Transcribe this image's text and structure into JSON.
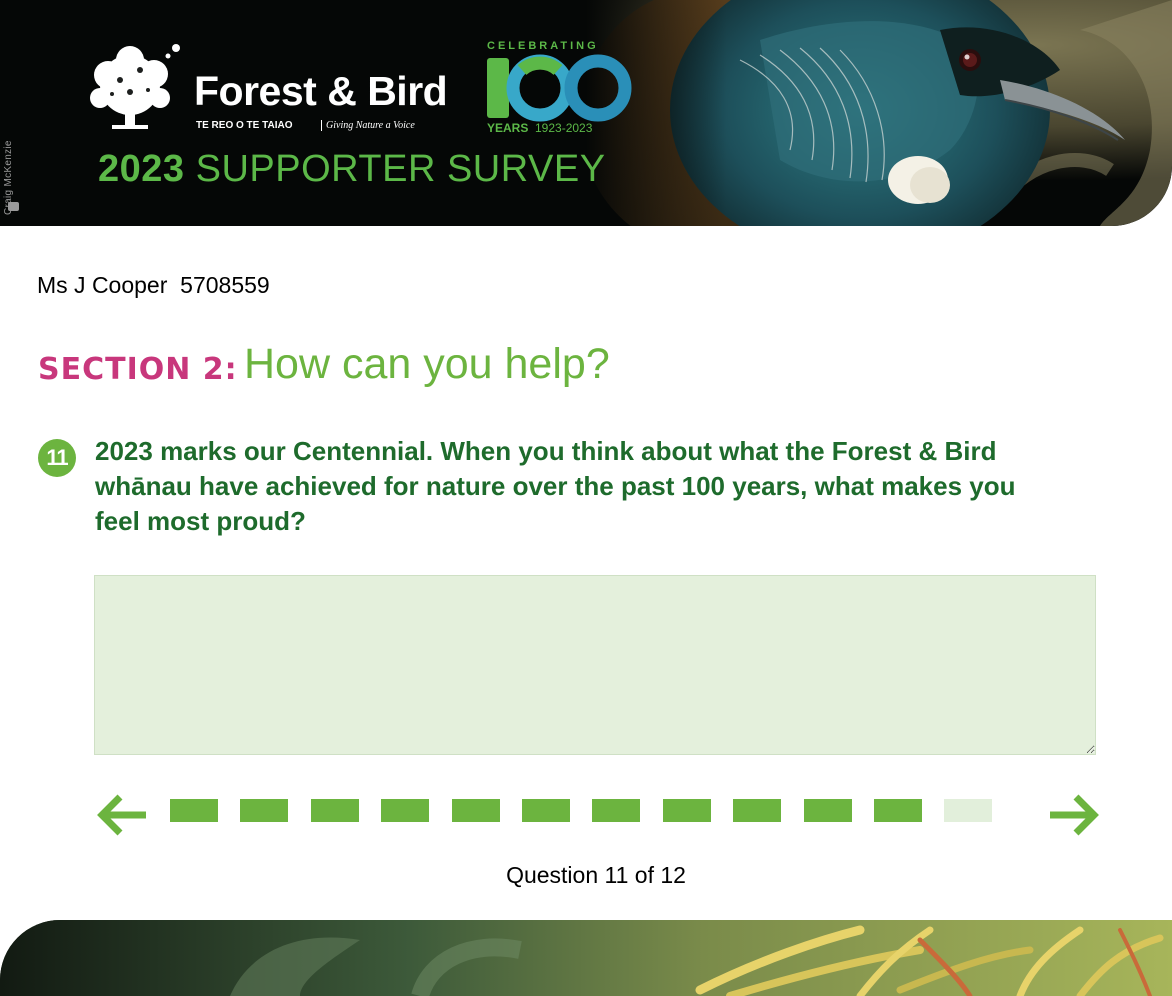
{
  "banner": {
    "photo_credit": "Craig McKenzie",
    "brand_name": "Forest & Bird",
    "tagline_reo": "TE REO O TE TAIAO",
    "tagline_english": "Giving Nature a Voice",
    "celebrating": "CELEBRATING",
    "hundred": "100",
    "years_label": "YEARS",
    "years_range": "1923-2023",
    "survey_year": "2023",
    "survey_title": "SUPPORTER SURVEY"
  },
  "supporter": {
    "name_and_id": "Ms J Cooper  5708559"
  },
  "section": {
    "label": "SECTION 2:",
    "title": "How can you help?"
  },
  "question": {
    "number": "11",
    "text": "2023 marks our Centennial. When you think about what the Forest & Bird whānau have achieved for nature over the past 100 years, what makes you feel most proud?",
    "answer_value": ""
  },
  "progress": {
    "current": 11,
    "total": 12,
    "label": "Question 11 of 12"
  },
  "colors": {
    "brand_green": "#6cb43f",
    "dark_green": "#1e6b2c",
    "section_pink": "#c8377c",
    "input_bg": "#e4f0dc",
    "empty_segment": "#e2efdb"
  },
  "icons": {
    "prev": "arrow-left-icon",
    "next": "arrow-right-icon",
    "logo": "tree-logo-icon",
    "camera": "camera-icon"
  }
}
